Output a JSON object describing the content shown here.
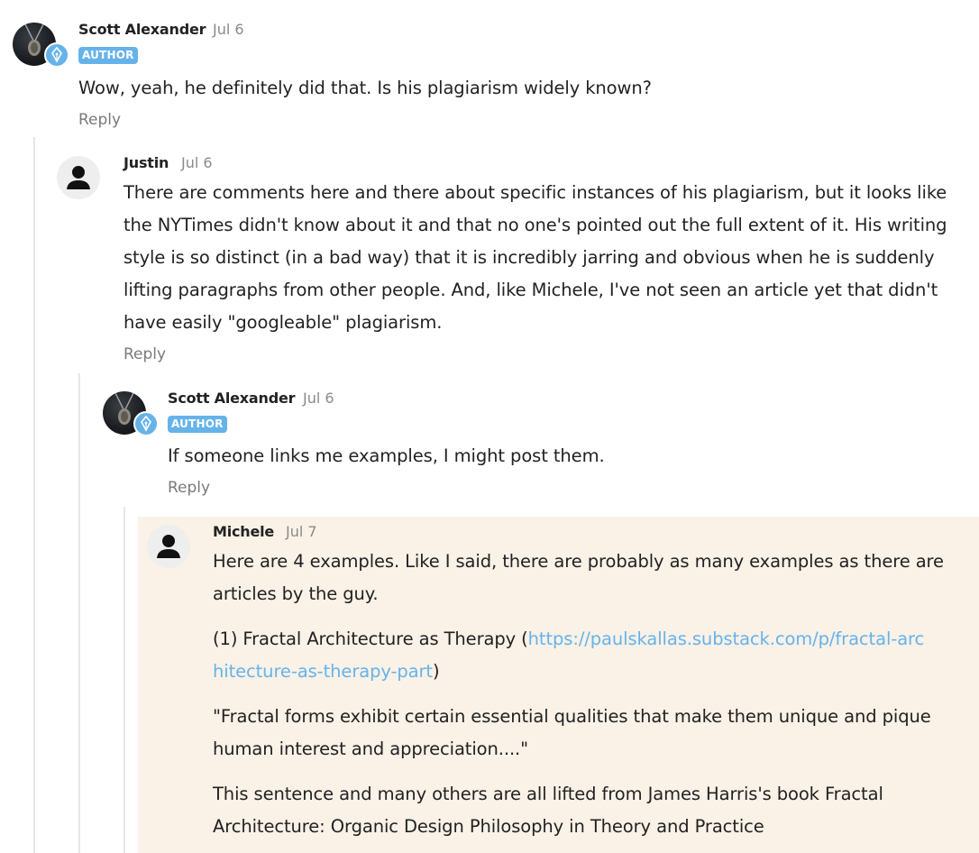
{
  "comments": [
    {
      "author": "Scott Alexander",
      "date": "Jul 6",
      "badge": "AUTHOR",
      "text": "Wow, yeah, he definitely did that. Is his plagiarism widely known?",
      "reply_label": "Reply"
    },
    {
      "author": "Justin",
      "date": "Jul 6",
      "text": "There are comments here and there about specific instances of his plagiarism, but it looks like the NYTimes didn't know about it and that no one's pointed out the full extent of it. His writing style is so distinct (in a bad way) that it is incredibly jarring and obvious when he is suddenly lifting paragraphs from other people. And, like Michele, I've not seen an article yet that didn't have easily \"googleable\" plagiarism.",
      "reply_label": "Reply"
    },
    {
      "author": "Scott Alexander",
      "date": "Jul 6",
      "badge": "AUTHOR",
      "text": "If someone links me examples, I might post them.",
      "reply_label": "Reply"
    },
    {
      "author": "Michele",
      "date": "Jul 7",
      "paragraphs": {
        "p1": "Here are 4 examples. Like I said, there are probably as many examples as there are articles by the guy.",
        "p2_prefix": "(1) Fractal Architecture as Therapy (",
        "p2_link": "https://paulskallas.substack.com/p/fractal-architecture-as-therapy-part",
        "p2_suffix": ")",
        "p3": "\"Fractal forms exhibit certain essential qualities that make them unique and pique human interest and appreciation....\"",
        "p4": "This sentence and many others are all lifted from James Harris's book Fractal Architecture: Organic Design Philosophy in Theory and Practice"
      }
    }
  ],
  "colors": {
    "accent": "#66b3ea",
    "highlight_bg": "#faf1e7",
    "thread_line": "#e6e6e6"
  },
  "icons": {
    "author_avatar": "pendant-photo-avatar",
    "author_badge": "fountain-pen-icon",
    "generic_avatar": "user-silhouette-icon"
  }
}
